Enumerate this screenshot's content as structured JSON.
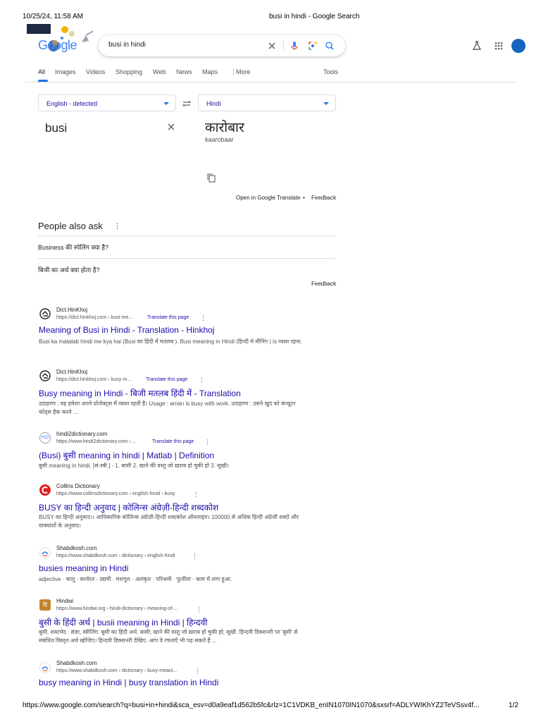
{
  "print": {
    "datetime": "10/25/24, 11:58 AM",
    "doc_title": "busi in hindi - Google Search",
    "url": "https://www.google.com/search?q=busi+in+hindi&sca_esv=d0a9eaf1d562b5fc&rlz=1C1VDKB_enIN1070IN1070&sxsrf=ADLYWIKhYZ2TeVSsv4f...",
    "page": "1/2"
  },
  "header": {
    "logo_text": "Google",
    "query": "busi in hindi"
  },
  "tabs": [
    "All",
    "Images",
    "Videos",
    "Shopping",
    "Web",
    "News",
    "Maps",
    "More",
    "Tools"
  ],
  "translate": {
    "source_lang": "English - detected",
    "target_lang": "Hindi",
    "source_text": "busi",
    "target_text": "कारोबार",
    "transliteration": "kaarobaar",
    "open_link": "Open in Google Translate",
    "feedback": "Feedback"
  },
  "paa": {
    "title": "People also ask",
    "questions": [
      "Business की स्पेलिंग क्या है?",
      "बिजी का अर्थ क्या होता है?"
    ],
    "feedback": "Feedback"
  },
  "results": [
    {
      "site": "Dict.HinKhoj",
      "url": "https://dict.hinkhoj.com › busi-me...",
      "translate": "Translate this page",
      "title": "Meaning of Busi in Hindi - Translation - Hinkhoj",
      "snippet": "Busi ka matalab hindi me kya hai (Busi का हिंदी में मतलब ). Busi meaning in Hindi (हिन्दी मे मीनिंग ) is व्यस्त रहना."
    },
    {
      "site": "Dict.HinKhoj",
      "url": "https://dict.hinkhoj.com › busy-m...",
      "translate": "Translate this page",
      "title": "Busy meaning in Hindi - बिजी मतलब हिंदी में - Translation",
      "snippet": "उदाहरण : वह हमेशा अपने प्रोजेक्ट्स में व्यस्त रहती है। Usage : aman is busy with work. उदाहरण : उसने खुद को कंप्यूटर कोड्स हैक करने ..."
    },
    {
      "site": "hindi2dictionary.com",
      "url": "https://www.hindi2dictionary.com › ...",
      "translate": "Translate this page",
      "title": "(Busi) बुसी meaning in hindi | Matlab | Definition",
      "snippet": "बुसी meaning in hindi. [सं-स्त्री.] - 1. बासी 2. खाने की वस्तु जो ख़राब हो चुकी हो 3. सूखी।"
    },
    {
      "site": "Collins Dictionary",
      "url": "https://www.collinsdictionary.com › english-hindi › busy",
      "translate": "",
      "title": "BUSY का हिन्दी अनुवाद | कोलिन्स अंग्रेज़ी-हिन्दी शब्दकोश",
      "snippet": "BUSY का हिन्दी अनुवाद।। आधिकारिक कोलिन्स अंग्रेज़ी-हिन्दी शब्दकोश ऑनलाइन। 100000 से अधिक हिन्दी अंग्रेजी शब्दों और वाक्यांशों के अनुवाद।"
    },
    {
      "site": "Shabdkosh.com",
      "url": "https://www.shabdkosh.com › dictionary › english-hindi",
      "translate": "",
      "title": "busies meaning in Hindi",
      "snippet": "adjective · चालू · कार्यरत · उद्यमी · मशगूल · अलंकृत · परिश्रमी · फुर्तीला · काम में लगा हुआ."
    },
    {
      "site": "Hindwi",
      "url": "https://www.hindwi.org › hindi-dictionary › meaning-of-...",
      "translate": "",
      "title": "बुसी के हिंदी अर्थ | busii meaning in Hindi | हिन्दवी",
      "snippet": "बुसी. शब्दभेद : संज्ञा, स्त्रीलिंग. बुसी का हिंदी अर्थ. बासी; खाने की वस्तु जो ख़राब हो चुकी हो; सूखी. हिन्दवी डिक्शनरी पर 'बुसी' से संबंधित विस्तृत अर्थ खोजिए। हिन्दवी डिक्शनरी देखिए. आप ये रचनाएँ भी पढ़ सकते हैं ..."
    },
    {
      "site": "Shabdkosh.com",
      "url": "https://www.shabdkosh.com › dictionary › busy-meani...",
      "translate": "",
      "title": "busy meaning in Hindi | busy translation in Hindi",
      "snippet": ""
    }
  ]
}
